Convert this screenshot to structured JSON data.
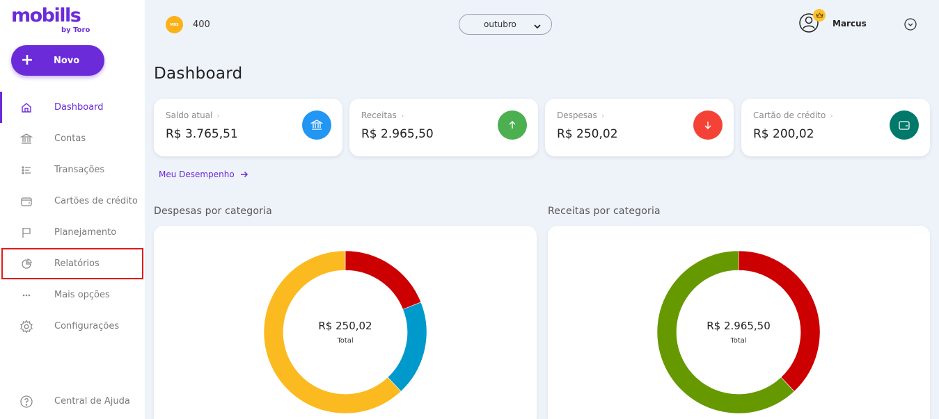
{
  "logo": {
    "brand": "mobills",
    "sub": "by Toro"
  },
  "new_button": {
    "label": "Novo"
  },
  "nav": [
    {
      "label": "Dashboard",
      "icon": "home-icon"
    },
    {
      "label": "Contas",
      "icon": "bank-icon"
    },
    {
      "label": "Transações",
      "icon": "list-icon"
    },
    {
      "label": "Cartões de crédito",
      "icon": "wallet-icon"
    },
    {
      "label": "Planejamento",
      "icon": "flag-icon"
    },
    {
      "label": "Relatórios",
      "icon": "pie-chart-icon"
    },
    {
      "label": "Mais opções",
      "icon": "more-icon"
    },
    {
      "label": "Configurações",
      "icon": "gear-icon"
    }
  ],
  "help": {
    "label": "Central de Ajuda",
    "icon": "help-icon"
  },
  "header": {
    "coins": "400",
    "coin_badge": "MBS",
    "month": "outubro",
    "user_name": "Marcus"
  },
  "page_title": "Dashboard",
  "cards": [
    {
      "label": "Saldo atual",
      "amount": "R$ 3.765,51",
      "color": "#2196f3",
      "icon": "bank-icon"
    },
    {
      "label": "Receitas",
      "amount": "R$ 2.965,50",
      "color": "#4caf50",
      "icon": "arrow-up-icon"
    },
    {
      "label": "Despesas",
      "amount": "R$ 250,02",
      "color": "#f44336",
      "icon": "arrow-down-icon"
    },
    {
      "label": "Cartão de crédito",
      "amount": "R$ 200,02",
      "color": "#00796b",
      "icon": "wallet-icon"
    }
  ],
  "performance_link": "Meu Desempenho",
  "expenses_section": {
    "title": "Despesas por categoria",
    "total": "R$ 250,02",
    "total_label": "Total"
  },
  "income_section": {
    "title": "Receitas por categoria",
    "total": "R$ 2.965,50",
    "total_label": "Total"
  },
  "chart_data": [
    {
      "type": "pie",
      "title": "Despesas por categoria",
      "series": [
        {
          "value": 0.19,
          "color": "#cc0000"
        },
        {
          "value": 0.19,
          "color": "#0099cc"
        },
        {
          "value": 0.62,
          "color": "#fbba1f"
        }
      ]
    },
    {
      "type": "pie",
      "title": "Receitas por categoria",
      "series": [
        {
          "value": 0.38,
          "color": "#cc0000"
        },
        {
          "value": 0.62,
          "color": "#669900"
        }
      ]
    }
  ]
}
